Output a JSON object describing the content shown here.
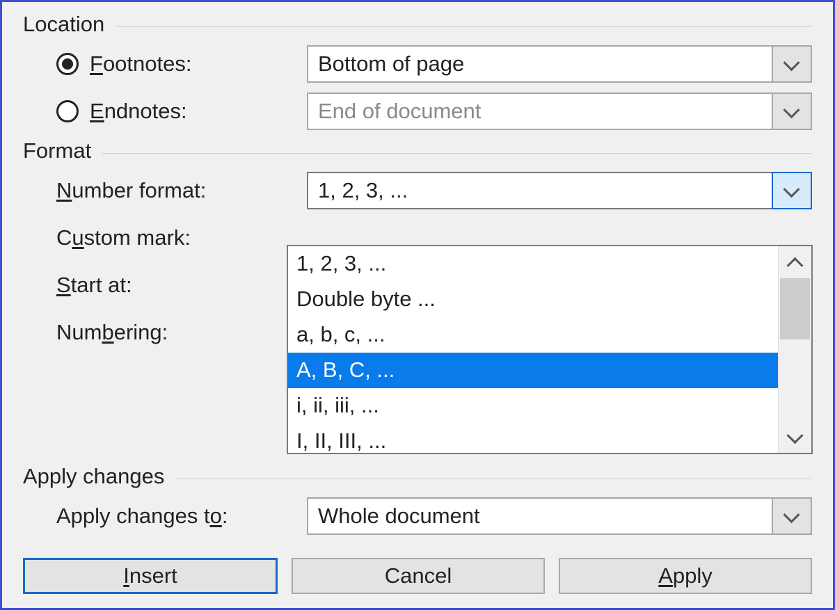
{
  "location": {
    "title": "Location",
    "footnotes_label": "ootnotes:",
    "footnotes_prefix": "F",
    "footnotes_value": "Bottom of page",
    "footnotes_selected": true,
    "endnotes_label": "ndnotes:",
    "endnotes_prefix": "E",
    "endnotes_value": "End of document"
  },
  "format": {
    "title": "Format",
    "number_format_label_pre": "",
    "number_format_uk": "N",
    "number_format_label_post": "umber format:",
    "number_format_value": "1, 2, 3, ...",
    "custom_mark_pre": "C",
    "custom_mark_uk": "u",
    "custom_mark_post": "stom mark:",
    "start_at_uk": "S",
    "start_at_post": "tart at:",
    "numbering_pre": "Num",
    "numbering_uk": "b",
    "numbering_post": "ering:",
    "dropdown_options": [
      "1, 2, 3, ...",
      "Double byte ...",
      "a, b, c, ...",
      "A, B, C, ...",
      "i, ii, iii, ...",
      "I, II, III, ..."
    ],
    "dropdown_selected_index": 3
  },
  "apply": {
    "title": "Apply changes",
    "label_pre": "Apply changes t",
    "label_uk": "o",
    "label_post": ":",
    "value": "Whole document"
  },
  "buttons": {
    "insert_uk": "I",
    "insert_post": "nsert",
    "cancel": "Cancel",
    "apply_uk": "A",
    "apply_post": "pply"
  }
}
